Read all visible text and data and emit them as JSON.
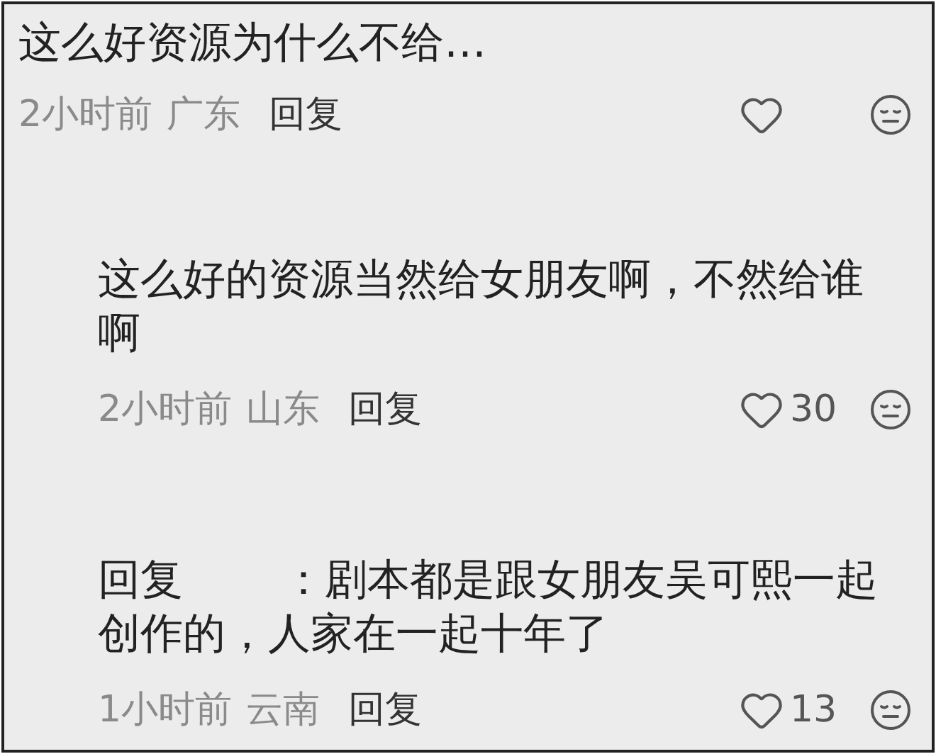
{
  "comments": [
    {
      "kind": "top",
      "text": "这么好资源为什么不给…",
      "time": "2小时前",
      "location": "广东",
      "reply_action": "回复"
    },
    {
      "kind": "reply",
      "text": "这么好的资源当然给女朋友啊，不然给谁啊",
      "time": "2小时前",
      "location": "山东",
      "reply_action": "回复",
      "likes": "30"
    },
    {
      "kind": "reply",
      "prefix": "回复",
      "text": "：剧本都是跟女朋友吴可熙一起创作的，人家在一起十年了",
      "time": "1小时前",
      "location": "云南",
      "reply_action": "回复",
      "likes": "13"
    }
  ]
}
